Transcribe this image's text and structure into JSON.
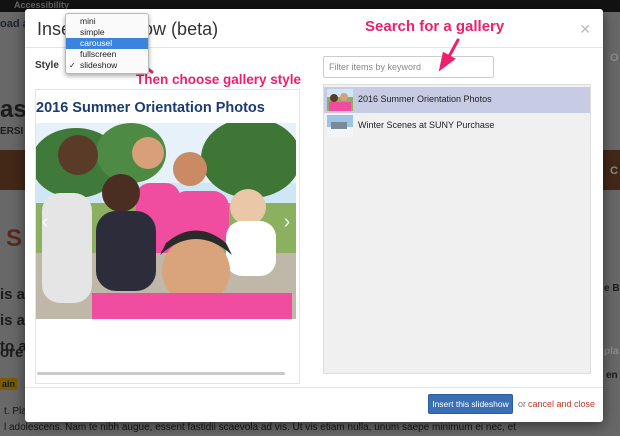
{
  "background": {
    "top_label": "Accessibility",
    "fragments": [
      "oad a",
      "as",
      "ERSI",
      "S",
      "is a",
      "is a",
      "to ac",
      "ore",
      "ain"
    ],
    "right_fragments": [
      "O",
      "C",
      "e B",
      "pla",
      "en"
    ],
    "bottom_text_1": "t. Place",
    "bottom_text_2": "l adolescens. Nam te nibh augue, essent fastidii scaevola ad vis. Ut vis etiam nulla, unum saepe minimum ei nec, et"
  },
  "modal": {
    "title": "Insert slideshow (beta)",
    "close_icon": "close-icon",
    "style_label": "Style",
    "style_options": [
      {
        "label": "mini",
        "selected": false,
        "checked": false
      },
      {
        "label": "simple",
        "selected": false,
        "checked": false
      },
      {
        "label": "carousel",
        "selected": true,
        "checked": false
      },
      {
        "label": "fullscreen",
        "selected": false,
        "checked": false
      },
      {
        "label": "slideshow",
        "selected": false,
        "checked": true
      }
    ],
    "check_mark": "✓",
    "preview": {
      "gallery_title": "2016 Summer Orientation Photos",
      "prev_icon": "‹",
      "next_icon": "›"
    },
    "search": {
      "placeholder": "Filter items by keyword",
      "value": ""
    },
    "galleries": [
      {
        "name": "2016 Summer Orientation Photos",
        "selected": true
      },
      {
        "name": "Winter Scenes at SUNY Purchase",
        "selected": false
      }
    ],
    "footer": {
      "insert_label": "Insert this slideshow",
      "or_text": "or",
      "cancel_label": "cancel and close"
    }
  },
  "annotations": {
    "search_hint": "Search for a gallery",
    "style_hint": "Then choose gallery style",
    "color": "#ee1f6c"
  },
  "colors": {
    "accent": "#3a6fb3",
    "selection": "#c7cbe3",
    "menu_highlight": "#3b84dd",
    "title_blue": "#1d3b6e"
  }
}
